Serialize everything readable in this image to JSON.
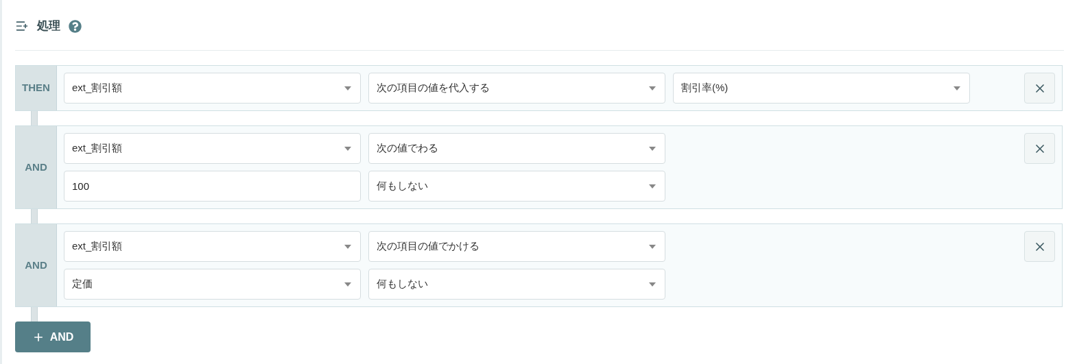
{
  "header": {
    "title": "処理"
  },
  "blocks": [
    {
      "label": "THEN",
      "rows": [
        [
          {
            "kind": "select",
            "value": "ext_割引額"
          },
          {
            "kind": "select",
            "value": "次の項目の値を代入する"
          },
          {
            "kind": "select",
            "value": "割引率(%)"
          }
        ]
      ]
    },
    {
      "label": "AND",
      "rows": [
        [
          {
            "kind": "select",
            "value": "ext_割引額"
          },
          {
            "kind": "select",
            "value": "次の値でわる"
          }
        ],
        [
          {
            "kind": "input",
            "value": "100"
          },
          {
            "kind": "select",
            "value": "何もしない"
          }
        ]
      ]
    },
    {
      "label": "AND",
      "rows": [
        [
          {
            "kind": "select",
            "value": "ext_割引額"
          },
          {
            "kind": "select",
            "value": "次の項目の値でかける"
          }
        ],
        [
          {
            "kind": "select",
            "value": "定価"
          },
          {
            "kind": "select",
            "value": "何もしない"
          }
        ]
      ]
    }
  ],
  "add_button": {
    "label": "AND"
  }
}
